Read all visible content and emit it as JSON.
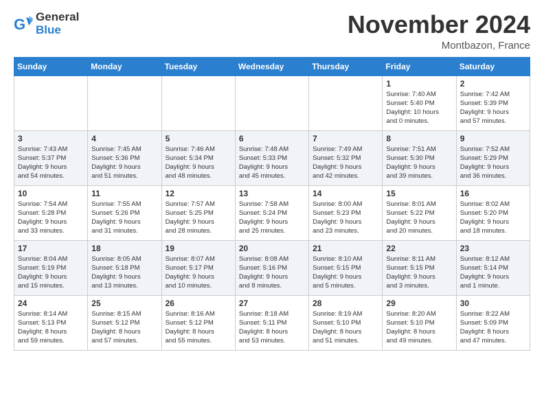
{
  "header": {
    "logo_general": "General",
    "logo_blue": "Blue",
    "month_title": "November 2024",
    "location": "Montbazon, France"
  },
  "weekdays": [
    "Sunday",
    "Monday",
    "Tuesday",
    "Wednesday",
    "Thursday",
    "Friday",
    "Saturday"
  ],
  "weeks": [
    [
      {
        "day": "",
        "info": ""
      },
      {
        "day": "",
        "info": ""
      },
      {
        "day": "",
        "info": ""
      },
      {
        "day": "",
        "info": ""
      },
      {
        "day": "",
        "info": ""
      },
      {
        "day": "1",
        "info": "Sunrise: 7:40 AM\nSunset: 5:40 PM\nDaylight: 10 hours\nand 0 minutes."
      },
      {
        "day": "2",
        "info": "Sunrise: 7:42 AM\nSunset: 5:39 PM\nDaylight: 9 hours\nand 57 minutes."
      }
    ],
    [
      {
        "day": "3",
        "info": "Sunrise: 7:43 AM\nSunset: 5:37 PM\nDaylight: 9 hours\nand 54 minutes."
      },
      {
        "day": "4",
        "info": "Sunrise: 7:45 AM\nSunset: 5:36 PM\nDaylight: 9 hours\nand 51 minutes."
      },
      {
        "day": "5",
        "info": "Sunrise: 7:46 AM\nSunset: 5:34 PM\nDaylight: 9 hours\nand 48 minutes."
      },
      {
        "day": "6",
        "info": "Sunrise: 7:48 AM\nSunset: 5:33 PM\nDaylight: 9 hours\nand 45 minutes."
      },
      {
        "day": "7",
        "info": "Sunrise: 7:49 AM\nSunset: 5:32 PM\nDaylight: 9 hours\nand 42 minutes."
      },
      {
        "day": "8",
        "info": "Sunrise: 7:51 AM\nSunset: 5:30 PM\nDaylight: 9 hours\nand 39 minutes."
      },
      {
        "day": "9",
        "info": "Sunrise: 7:52 AM\nSunset: 5:29 PM\nDaylight: 9 hours\nand 36 minutes."
      }
    ],
    [
      {
        "day": "10",
        "info": "Sunrise: 7:54 AM\nSunset: 5:28 PM\nDaylight: 9 hours\nand 33 minutes."
      },
      {
        "day": "11",
        "info": "Sunrise: 7:55 AM\nSunset: 5:26 PM\nDaylight: 9 hours\nand 31 minutes."
      },
      {
        "day": "12",
        "info": "Sunrise: 7:57 AM\nSunset: 5:25 PM\nDaylight: 9 hours\nand 28 minutes."
      },
      {
        "day": "13",
        "info": "Sunrise: 7:58 AM\nSunset: 5:24 PM\nDaylight: 9 hours\nand 25 minutes."
      },
      {
        "day": "14",
        "info": "Sunrise: 8:00 AM\nSunset: 5:23 PM\nDaylight: 9 hours\nand 23 minutes."
      },
      {
        "day": "15",
        "info": "Sunrise: 8:01 AM\nSunset: 5:22 PM\nDaylight: 9 hours\nand 20 minutes."
      },
      {
        "day": "16",
        "info": "Sunrise: 8:02 AM\nSunset: 5:20 PM\nDaylight: 9 hours\nand 18 minutes."
      }
    ],
    [
      {
        "day": "17",
        "info": "Sunrise: 8:04 AM\nSunset: 5:19 PM\nDaylight: 9 hours\nand 15 minutes."
      },
      {
        "day": "18",
        "info": "Sunrise: 8:05 AM\nSunset: 5:18 PM\nDaylight: 9 hours\nand 13 minutes."
      },
      {
        "day": "19",
        "info": "Sunrise: 8:07 AM\nSunset: 5:17 PM\nDaylight: 9 hours\nand 10 minutes."
      },
      {
        "day": "20",
        "info": "Sunrise: 8:08 AM\nSunset: 5:16 PM\nDaylight: 9 hours\nand 8 minutes."
      },
      {
        "day": "21",
        "info": "Sunrise: 8:10 AM\nSunset: 5:15 PM\nDaylight: 9 hours\nand 5 minutes."
      },
      {
        "day": "22",
        "info": "Sunrise: 8:11 AM\nSunset: 5:15 PM\nDaylight: 9 hours\nand 3 minutes."
      },
      {
        "day": "23",
        "info": "Sunrise: 8:12 AM\nSunset: 5:14 PM\nDaylight: 9 hours\nand 1 minute."
      }
    ],
    [
      {
        "day": "24",
        "info": "Sunrise: 8:14 AM\nSunset: 5:13 PM\nDaylight: 8 hours\nand 59 minutes."
      },
      {
        "day": "25",
        "info": "Sunrise: 8:15 AM\nSunset: 5:12 PM\nDaylight: 8 hours\nand 57 minutes."
      },
      {
        "day": "26",
        "info": "Sunrise: 8:16 AM\nSunset: 5:12 PM\nDaylight: 8 hours\nand 55 minutes."
      },
      {
        "day": "27",
        "info": "Sunrise: 8:18 AM\nSunset: 5:11 PM\nDaylight: 8 hours\nand 53 minutes."
      },
      {
        "day": "28",
        "info": "Sunrise: 8:19 AM\nSunset: 5:10 PM\nDaylight: 8 hours\nand 51 minutes."
      },
      {
        "day": "29",
        "info": "Sunrise: 8:20 AM\nSunset: 5:10 PM\nDaylight: 8 hours\nand 49 minutes."
      },
      {
        "day": "30",
        "info": "Sunrise: 8:22 AM\nSunset: 5:09 PM\nDaylight: 8 hours\nand 47 minutes."
      }
    ]
  ]
}
